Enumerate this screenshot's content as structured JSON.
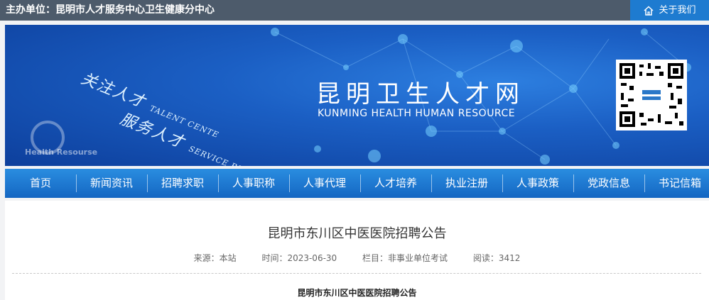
{
  "topbar": {
    "host": "主办单位：昆明市人才服务中心卫生健康分中心",
    "about": "关于我们",
    "about_icon": "home-icon"
  },
  "banner": {
    "slogan1_cn": "关注人才",
    "slogan1_en": "TALENT CENTE",
    "slogan2_cn": "服务人才",
    "slogan2_en": "SERVICE RESOURCES",
    "logo_text": "Health Resourse",
    "site_title": "昆明卫生人才网",
    "site_subtitle": "KUNMING HEALTH HUMAN RESOURCE"
  },
  "nav": {
    "items": [
      "首页",
      "新闻资讯",
      "招聘求职",
      "人事职称",
      "人事代理",
      "人才培养",
      "执业注册",
      "人事政策",
      "党政信息",
      "书记信箱"
    ]
  },
  "article": {
    "title": "昆明市东川区中医医院招聘公告",
    "source": "来源：本站",
    "time": "时间：2023-06-30",
    "column": "栏目：非事业单位考试",
    "views": "阅读：3412",
    "body_title": "昆明市东川区中医医院招聘公告"
  },
  "colors": {
    "topbar": "#4d5b6b",
    "accent": "#1e7bd0",
    "nav": "#1a77d0"
  }
}
